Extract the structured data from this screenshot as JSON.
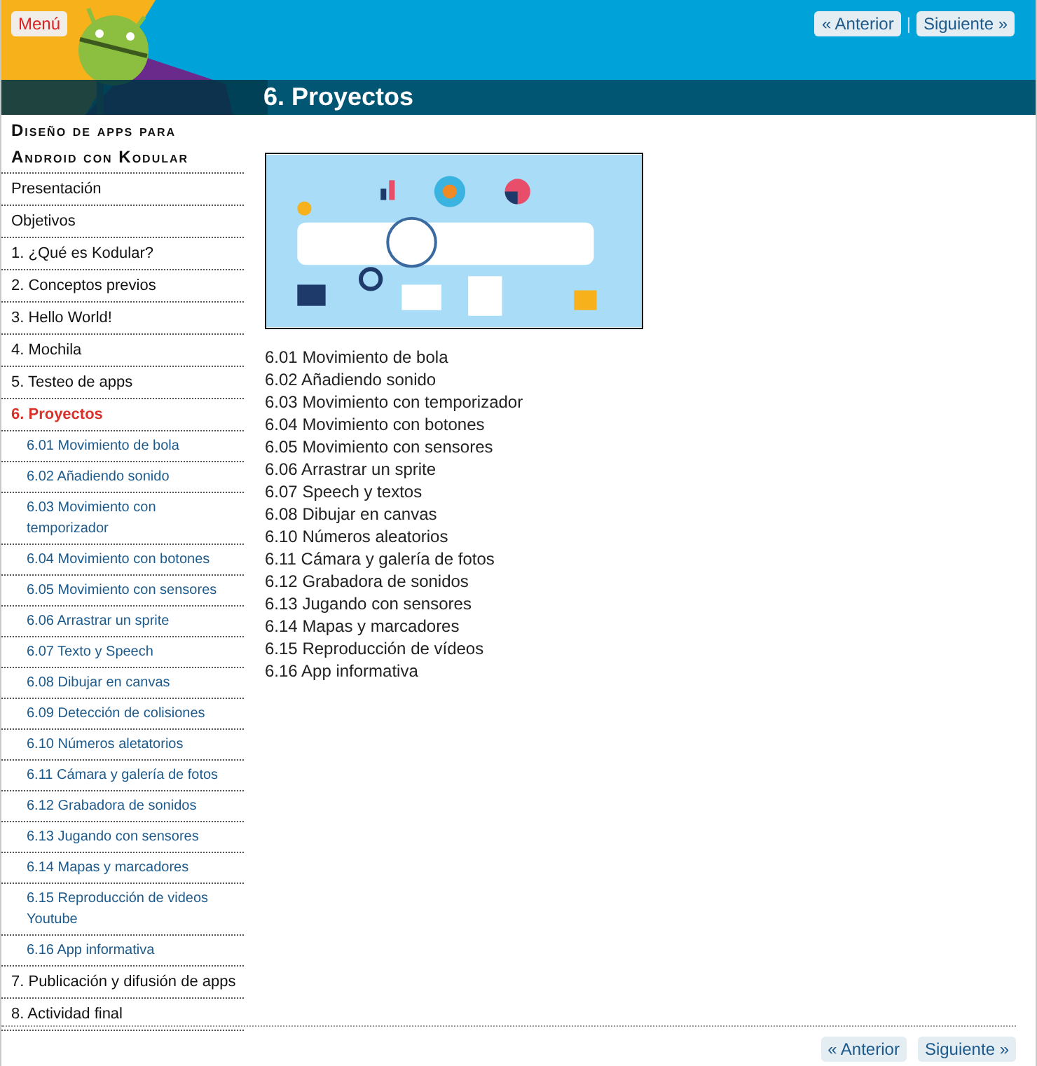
{
  "header": {
    "menu_button": "Menú",
    "nav": {
      "previous": "« Anterior",
      "separator": "|",
      "next": "Siguiente »"
    },
    "title": "6. Proyectos"
  },
  "sidebar": {
    "title": "Diseño de apps para Android con Kodular",
    "items": [
      {
        "label": "Presentación",
        "selected": false
      },
      {
        "label": "Objetivos",
        "selected": false
      },
      {
        "label": "1. ¿Qué es Kodular?",
        "selected": false
      },
      {
        "label": "2. Conceptos previos",
        "selected": false
      },
      {
        "label": "3. Hello World!",
        "selected": false
      },
      {
        "label": "4. Mochila",
        "selected": false
      },
      {
        "label": "5. Testeo de apps",
        "selected": false
      },
      {
        "label": "6. Proyectos",
        "selected": true,
        "children": [
          {
            "label": "6.01 Movimiento de bola",
            "selected": false
          },
          {
            "label": "6.02 Añadiendo sonido",
            "selected": false
          },
          {
            "label": "6.03 Movimiento con temporizador",
            "selected": false
          },
          {
            "label": "6.04 Movimiento con botones",
            "selected": false
          },
          {
            "label": "6.05 Movimiento con sensores",
            "selected": false
          },
          {
            "label": "6.06 Arrastrar un sprite",
            "selected": false
          },
          {
            "label": "6.07 Texto y Speech",
            "selected": false
          },
          {
            "label": "6.08 Dibujar en canvas",
            "selected": false
          },
          {
            "label": "6.09 Detección de colisiones",
            "selected": false
          },
          {
            "label": "6.10 Números aletatorios",
            "selected": false
          },
          {
            "label": "6.11 Cámara y galería de fotos",
            "selected": false
          },
          {
            "label": "6.12 Grabadora de sonidos",
            "selected": false
          },
          {
            "label": "6.13 Jugando con sensores",
            "selected": false
          },
          {
            "label": "6.14 Mapas y marcadores",
            "selected": false
          },
          {
            "label": "6.15 Reproducción de videos Youtube",
            "selected": false
          },
          {
            "label": "6.16 App informativa",
            "selected": false
          }
        ]
      },
      {
        "label": "7. Publicación y difusión de apps",
        "selected": false
      },
      {
        "label": "8. Actividad final",
        "selected": false
      }
    ]
  },
  "content": {
    "image": {
      "kind": "picture"
    },
    "links": [
      "6.01 Movimiento de bola",
      "6.02 Añadiendo sonido",
      "6.03 Movimiento con temporizador",
      "6.04 Movimiento con botones",
      "6.05 Movimiento con sensores",
      "6.06 Arrastrar un sprite",
      "6.07 Speech y textos",
      "6.08 Dibujar en canvas",
      "6.10 Números aleatorios",
      "6.11 Cámara y galería de fotos",
      "6.12 Grabadora de sonidos",
      "6.13 Jugando con sensores",
      "6.14 Mapas y marcadores",
      "6.15 Reproducción de vídeos",
      "6.16 App informativa"
    ]
  },
  "footer_nav": {
    "previous": "« Anterior",
    "next": "Siguiente »"
  }
}
